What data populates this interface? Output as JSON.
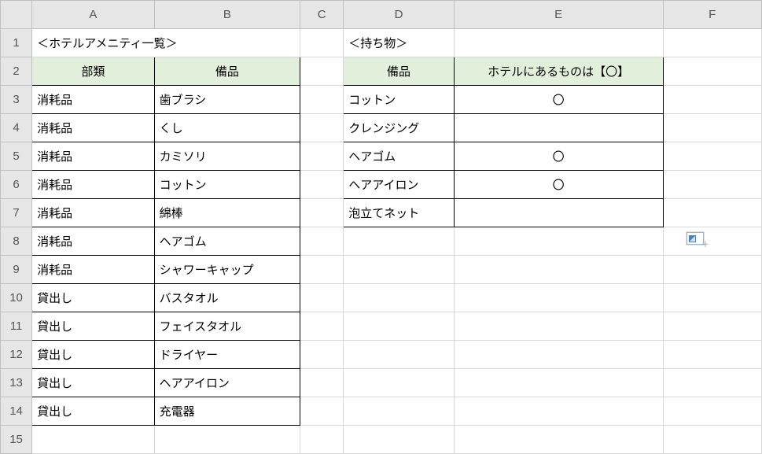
{
  "colHeaders": [
    "A",
    "B",
    "C",
    "D",
    "E",
    "F"
  ],
  "rowHeaders": [
    "1",
    "2",
    "3",
    "4",
    "5",
    "6",
    "7",
    "8",
    "9",
    "10",
    "11",
    "12",
    "13",
    "14",
    "15"
  ],
  "titleLeft": "＜ホテルアメニティ一覧＞",
  "titleRight": "＜持ち物＞",
  "leftHeader": {
    "category": "部類",
    "item": "備品"
  },
  "rightHeader": {
    "item": "備品",
    "has": "ホテルにあるものは【〇】"
  },
  "amenities": [
    {
      "category": "消耗品",
      "item": "歯ブラシ"
    },
    {
      "category": "消耗品",
      "item": "くし"
    },
    {
      "category": "消耗品",
      "item": "カミソリ"
    },
    {
      "category": "消耗品",
      "item": "コットン"
    },
    {
      "category": "消耗品",
      "item": "綿棒"
    },
    {
      "category": "消耗品",
      "item": "ヘアゴム"
    },
    {
      "category": "消耗品",
      "item": "シャワーキャップ"
    },
    {
      "category": "貸出し",
      "item": "バスタオル"
    },
    {
      "category": "貸出し",
      "item": "フェイスタオル"
    },
    {
      "category": "貸出し",
      "item": "ドライヤー"
    },
    {
      "category": "貸出し",
      "item": "ヘアアイロン"
    },
    {
      "category": "貸出し",
      "item": "充電器"
    }
  ],
  "belongings": [
    {
      "item": "コットン",
      "has": "〇"
    },
    {
      "item": "クレンジング",
      "has": ""
    },
    {
      "item": "ヘアゴム",
      "has": "〇"
    },
    {
      "item": "ヘアアイロン",
      "has": "〇"
    },
    {
      "item": "泡立てネット",
      "has": ""
    }
  ],
  "chart_data": {
    "type": "table",
    "tables": [
      {
        "title": "＜ホテルアメニティ一覧＞",
        "columns": [
          "部類",
          "備品"
        ],
        "rows": [
          [
            "消耗品",
            "歯ブラシ"
          ],
          [
            "消耗品",
            "くし"
          ],
          [
            "消耗品",
            "カミソリ"
          ],
          [
            "消耗品",
            "コットン"
          ],
          [
            "消耗品",
            "綿棒"
          ],
          [
            "消耗品",
            "ヘアゴム"
          ],
          [
            "消耗品",
            "シャワーキャップ"
          ],
          [
            "貸出し",
            "バスタオル"
          ],
          [
            "貸出し",
            "フェイスタオル"
          ],
          [
            "貸出し",
            "ドライヤー"
          ],
          [
            "貸出し",
            "ヘアアイロン"
          ],
          [
            "貸出し",
            "充電器"
          ]
        ]
      },
      {
        "title": "＜持ち物＞",
        "columns": [
          "備品",
          "ホテルにあるものは【〇】"
        ],
        "rows": [
          [
            "コットン",
            "〇"
          ],
          [
            "クレンジング",
            ""
          ],
          [
            "ヘアゴム",
            "〇"
          ],
          [
            "ヘアアイロン",
            "〇"
          ],
          [
            "泡立てネット",
            ""
          ]
        ]
      }
    ]
  }
}
